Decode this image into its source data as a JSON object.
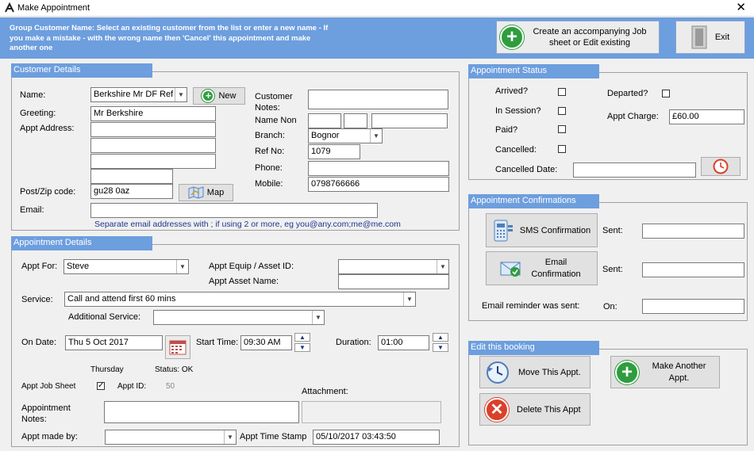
{
  "window": {
    "title": "Make Appointment",
    "close_glyph": "✕"
  },
  "banner": {
    "message": "Group Customer Name: Select an existing customer from the list or enter a new name - If you make a mistake - with the wrong name then 'Cancel' this appointment and make another one",
    "job_sheet_label": "Create an accompanying Job sheet or Edit existing",
    "exit_label": "Exit"
  },
  "customer": {
    "title": "Customer Details",
    "name_label": "Name:",
    "name_value": "Berkshire  Mr  DF Ref",
    "new_label": "New",
    "greeting_label": "Greeting:",
    "greeting_value": "Mr  Berkshire",
    "address_label": "Appt Address:",
    "postcode_label": "Post/Zip code:",
    "postcode_value": "gu28 0az",
    "map_label": "Map",
    "email_label": "Email:",
    "email_hint": "Separate email addresses with ; if using 2 or more, eg you@any.com;me@me.com",
    "notes_label": "Customer Notes:",
    "name_non_label": "Name Non",
    "branch_label": "Branch:",
    "branch_value": "Bognor",
    "ref_label": "Ref No:",
    "ref_value": "1079",
    "phone_label": "Phone:",
    "mobile_label": "Mobile:",
    "mobile_value": "0798766666"
  },
  "appointment": {
    "title": "Appointment Details",
    "appt_for_label": "Appt For:",
    "appt_for_value": "Steve",
    "equip_label": "Appt Equip / Asset ID:",
    "asset_name_label": "Appt Asset Name:",
    "service_label": "Service:",
    "service_value": "Call and attend first 60 mins",
    "additional_label": "Additional Service:",
    "on_date_label": "On Date:",
    "on_date_value": "Thu 5 Oct 2017",
    "day_text": "Thursday",
    "start_label": "Start Time:",
    "start_value": "09:30 AM",
    "status_text": "Status: OK",
    "duration_label": "Duration:",
    "duration_value": "01:00",
    "job_sheet_label": "Appt Job Sheet",
    "appt_id_label": "Appt ID:",
    "appt_id_value": "50",
    "attachment_label": "Attachment:",
    "notes_label": "Appointment Notes:",
    "made_by_label": "Appt made by:",
    "timestamp_label": "Appt Time Stamp",
    "timestamp_value": "05/10/2017 03:43:50"
  },
  "status": {
    "title": "Appointment Status",
    "arrived_label": "Arrived?",
    "in_session_label": "In Session?",
    "paid_label": "Paid?",
    "cancelled_label": "Cancelled:",
    "departed_label": "Departed?",
    "charge_label": "Appt Charge:",
    "charge_value": "£60.00",
    "cancelled_date_label": "Cancelled Date:"
  },
  "confirmations": {
    "title": "Appointment Confirmations",
    "sms_label": "SMS Confirmation",
    "sent_label_1": "Sent:",
    "email_label": "Email Confirmation",
    "sent_label_2": "Sent:",
    "reminder_label": "Email reminder was sent:",
    "on_label": "On:"
  },
  "edit": {
    "title": "Edit this booking",
    "move_label": "Move This Appt.",
    "make_another_label": "Make Another Appt.",
    "delete_label": "Delete This Appt"
  },
  "colors": {
    "accent": "#6d9ede",
    "green": "#2e9d3e",
    "red": "#d9412a"
  }
}
